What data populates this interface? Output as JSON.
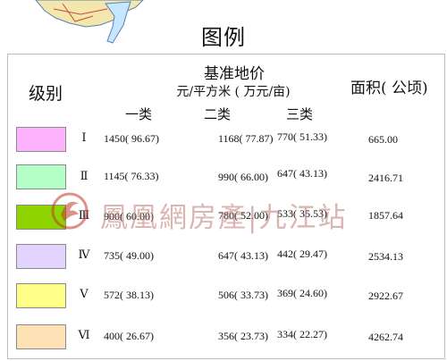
{
  "title": "图例",
  "headers": {
    "level": "级别",
    "price": "基准地价",
    "unit": "元/平方米 ( 万元/亩)",
    "area": "面积( 公顷)",
    "categories": [
      "一类",
      "二类",
      "三类"
    ]
  },
  "rows": [
    {
      "level": "Ⅰ",
      "color": "#ffb3ff",
      "c1": "1450( 96.67)",
      "c2": "1168( 77.87)",
      "c3": "770( 51.33)",
      "area": "665.00"
    },
    {
      "level": "Ⅱ",
      "color": "#b3ffc6",
      "c1": "1145( 76.33)",
      "c2": "990( 66.00)",
      "c3": "647( 43.13)",
      "area": "2416.71"
    },
    {
      "level": "Ⅲ",
      "color": "#8fd400",
      "c1": "900( 60.00)",
      "c2": "780( 52.00)",
      "c3": "533( 35.53)",
      "area": "1857.64"
    },
    {
      "level": "Ⅳ",
      "color": "#e3d4ff",
      "c1": "735( 49.00)",
      "c2": "647( 43.13)",
      "c3": "442( 29.47)",
      "area": "2534.13"
    },
    {
      "level": "Ⅴ",
      "color": "#ffff88",
      "c1": "572( 38.13)",
      "c2": "506( 33.73)",
      "c3": "369( 24.60)",
      "area": "2922.67"
    },
    {
      "level": "Ⅵ",
      "color": "#ffe1b6",
      "c1": "400( 26.67)",
      "c2": "356( 23.73)",
      "c3": "334( 22.27)",
      "area": "4262.74"
    }
  ],
  "watermark": {
    "text": "鳳凰網房產|九江站",
    "color": "#c0392b"
  },
  "map": {
    "fill_colors": [
      "#f3e7ae",
      "#c7e6ff"
    ]
  }
}
